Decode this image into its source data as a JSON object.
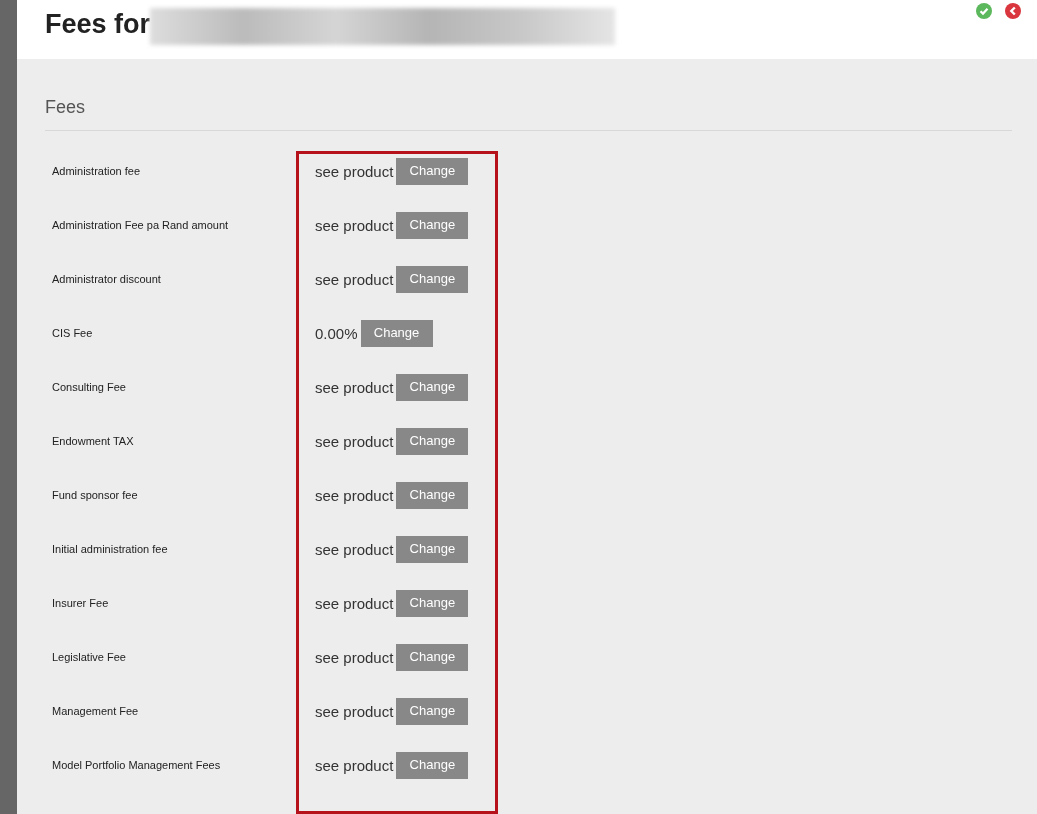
{
  "header": {
    "title": "Fees for"
  },
  "section": {
    "title": "Fees"
  },
  "fees": [
    {
      "label": "Administration fee",
      "value": "see product",
      "button": "Change"
    },
    {
      "label": "Administration Fee pa Rand amount",
      "value": "see product",
      "button": "Change"
    },
    {
      "label": "Administrator discount",
      "value": "see product",
      "button": "Change"
    },
    {
      "label": "CIS Fee",
      "value": "0.00%",
      "button": "Change"
    },
    {
      "label": "Consulting Fee",
      "value": "see product",
      "button": "Change"
    },
    {
      "label": "Endowment TAX",
      "value": "see product",
      "button": "Change"
    },
    {
      "label": "Fund sponsor fee",
      "value": "see product",
      "button": "Change"
    },
    {
      "label": "Initial administration fee",
      "value": "see product",
      "button": "Change"
    },
    {
      "label": "Insurer Fee",
      "value": "see product",
      "button": "Change"
    },
    {
      "label": "Legislative Fee",
      "value": "see product",
      "button": "Change"
    },
    {
      "label": "Management Fee",
      "value": "see product",
      "button": "Change"
    },
    {
      "label": "Model Portfolio Management Fees",
      "value": "see product",
      "button": "Change"
    }
  ]
}
